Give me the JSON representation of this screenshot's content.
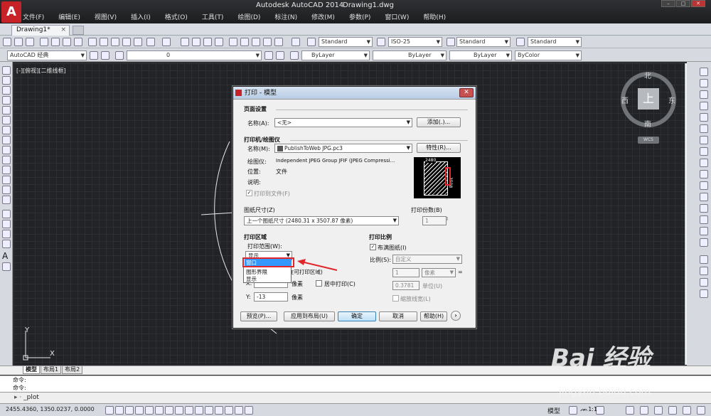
{
  "app": {
    "title": "Autodesk AutoCAD 2014",
    "document": "Drawing1.dwg",
    "logo": "A"
  },
  "menu": [
    "文件(F)",
    "编辑(E)",
    "视图(V)",
    "插入(I)",
    "格式(O)",
    "工具(T)",
    "绘图(D)",
    "标注(N)",
    "修改(M)",
    "参数(P)",
    "窗口(W)",
    "帮助(H)"
  ],
  "tabs": {
    "doc": "Drawing1*",
    "close": "×"
  },
  "toolbar": {
    "textstyle": "Standard",
    "dimstyle": "ISO-25",
    "tablestyle": "Standard",
    "mleaderstyle": "Standard",
    "workspace": "AutoCAD 经典",
    "layer": "0",
    "color": "ByLayer",
    "linetype": "ByLayer",
    "lineweight": "ByLayer",
    "plotstyle": "ByColor"
  },
  "canvas": {
    "view_label": "[-][俯视][二维线框]",
    "ucs_y": "Y",
    "ucs_x": "X"
  },
  "compass": {
    "north": "北",
    "south": "南",
    "east": "东",
    "west": "西",
    "top": "上",
    "wcs": "WCS"
  },
  "layout_tabs": [
    "模型",
    "布局1",
    "布局2"
  ],
  "command": {
    "history1": "命令:",
    "history2": "命令:",
    "prompt": "_plot"
  },
  "status": {
    "coords": "2455.4360, 1350.0237, 0.0000",
    "model": "模型",
    "scale": "1:1"
  },
  "dialog": {
    "title": "打印 - 模型",
    "page_setup": {
      "group": "页面设置",
      "name_label": "名称(A):",
      "name_value": "<无>",
      "add_btn": "添加(.)..."
    },
    "printer": {
      "group": "打印机/绘图仪",
      "name_label": "名称(M):",
      "name_value": "PublishToWeb JPG.pc3",
      "props_btn": "特性(R)...",
      "plotter_label": "绘图仪:",
      "plotter_value": "Independent JPEG Group JFIF (JPEG Compressi...",
      "where_label": "位置:",
      "where_value": "文件",
      "desc_label": "说明:",
      "to_file": "打印到文件(F)",
      "preview_w": "2480",
      "preview_h": "3508"
    },
    "paper": {
      "group": "图纸尺寸(Z)",
      "value": "上一个图纸尺寸  (2480.31 x 3507.87 像素)"
    },
    "copies": {
      "group": "打印份数(B)",
      "value": "1"
    },
    "area": {
      "group": "打印区域",
      "range_label": "打印范围(W):",
      "range_value": "显示",
      "options": [
        "窗口",
        "图形界限",
        "显示"
      ]
    },
    "offset": {
      "group": "打印偏移(原点设置在可打印区域)",
      "x_label": "X:",
      "x_value": "",
      "y_label": "Y:",
      "y_value": "-13",
      "unit": "像素",
      "center": "居中打印(C)"
    },
    "scale": {
      "group": "打印比例",
      "fit": "布满图纸(I)",
      "ratio_label": "比例(S):",
      "ratio_value": "自定义",
      "val1": "1",
      "unit1": "像素",
      "eq": "=",
      "val2": "0.3781",
      "unit2": "单位(U)",
      "lineweight": "缩放线宽(L)"
    },
    "buttons": {
      "preview": "预览(P)...",
      "apply": "应用到布局(U)",
      "ok": "确定",
      "cancel": "取消",
      "help": "帮助(H)",
      "expand": "›"
    }
  },
  "watermark": {
    "brand": "Bai 经验",
    "url": "jingyan.baidu.com"
  },
  "colors": {
    "accent_red": "#e0262a",
    "canvas_bg": "#212326",
    "selection": "#3399ff"
  }
}
